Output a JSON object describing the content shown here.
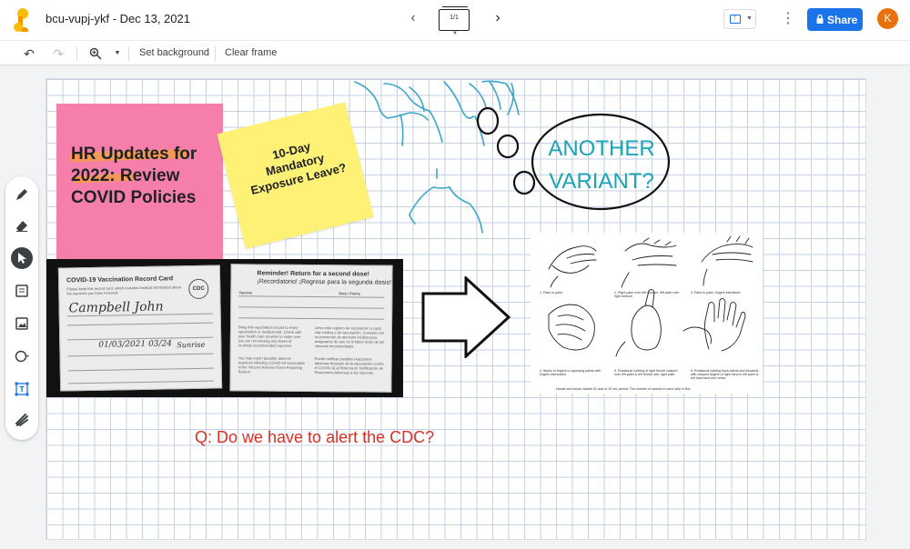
{
  "header": {
    "doc_title": "bcu-vupj-ykf - Dec 13, 2021",
    "frame_indicator": "1/1",
    "share_label": "Share",
    "avatar_initial": "K"
  },
  "toolbar": {
    "set_background": "Set background",
    "clear_frame": "Clear frame"
  },
  "tools": [
    "pen",
    "eraser",
    "select",
    "sticky-note",
    "image",
    "shape",
    "text-box",
    "laser"
  ],
  "canvas": {
    "pink_note": {
      "text": "HR Updates for 2022: Review COVID Policies",
      "color": "#f57faa"
    },
    "yellow_note": {
      "text": "10-Day Mandatory Exposure Leave?",
      "color": "#fff176"
    },
    "vaccine_card": {
      "left_title": "COVID-19 Vaccination Record Card",
      "left_logo": "CDC",
      "left_name": "Campbell John",
      "left_date": "01/03/2021 03/24",
      "left_site": "Sunrise",
      "right_title": "Reminder! Return for a second dose!",
      "right_subtitle": "¡Recordatorio! ¡Regrese para la segunda dosis!",
      "right_col1": "Vaccine",
      "right_col2": "Date / Fecha"
    },
    "bubble_text": "ANOTHER VARIANT?",
    "bubble_color": "#1ba3b8",
    "handwash": {
      "captions": [
        "1. Palm to palm",
        "2. Right palm over left dorsum, left palm over right dorsum",
        "3. Palm to palm, fingers interlaced",
        "4. Backs of fingers to opposing palms with fingers interlocked",
        "5. Rotational rubbing of right thumb clasped over left palm & left thumb over right palm",
        "6. Rotational rubbing back-wards and forwards with clasped fingers of right hand in left palm & left hand and vice versa"
      ],
      "footer": "Hands and wrists rubbed 6X and of 10 sec period. The number of strokes in each step is five."
    },
    "question": "Q: Do we have to alert the CDC?",
    "question_color": "#d93025"
  },
  "colors": {
    "accent": "#1a73e8",
    "avatar": "#e8710a",
    "grid": "#c6d0e6"
  }
}
